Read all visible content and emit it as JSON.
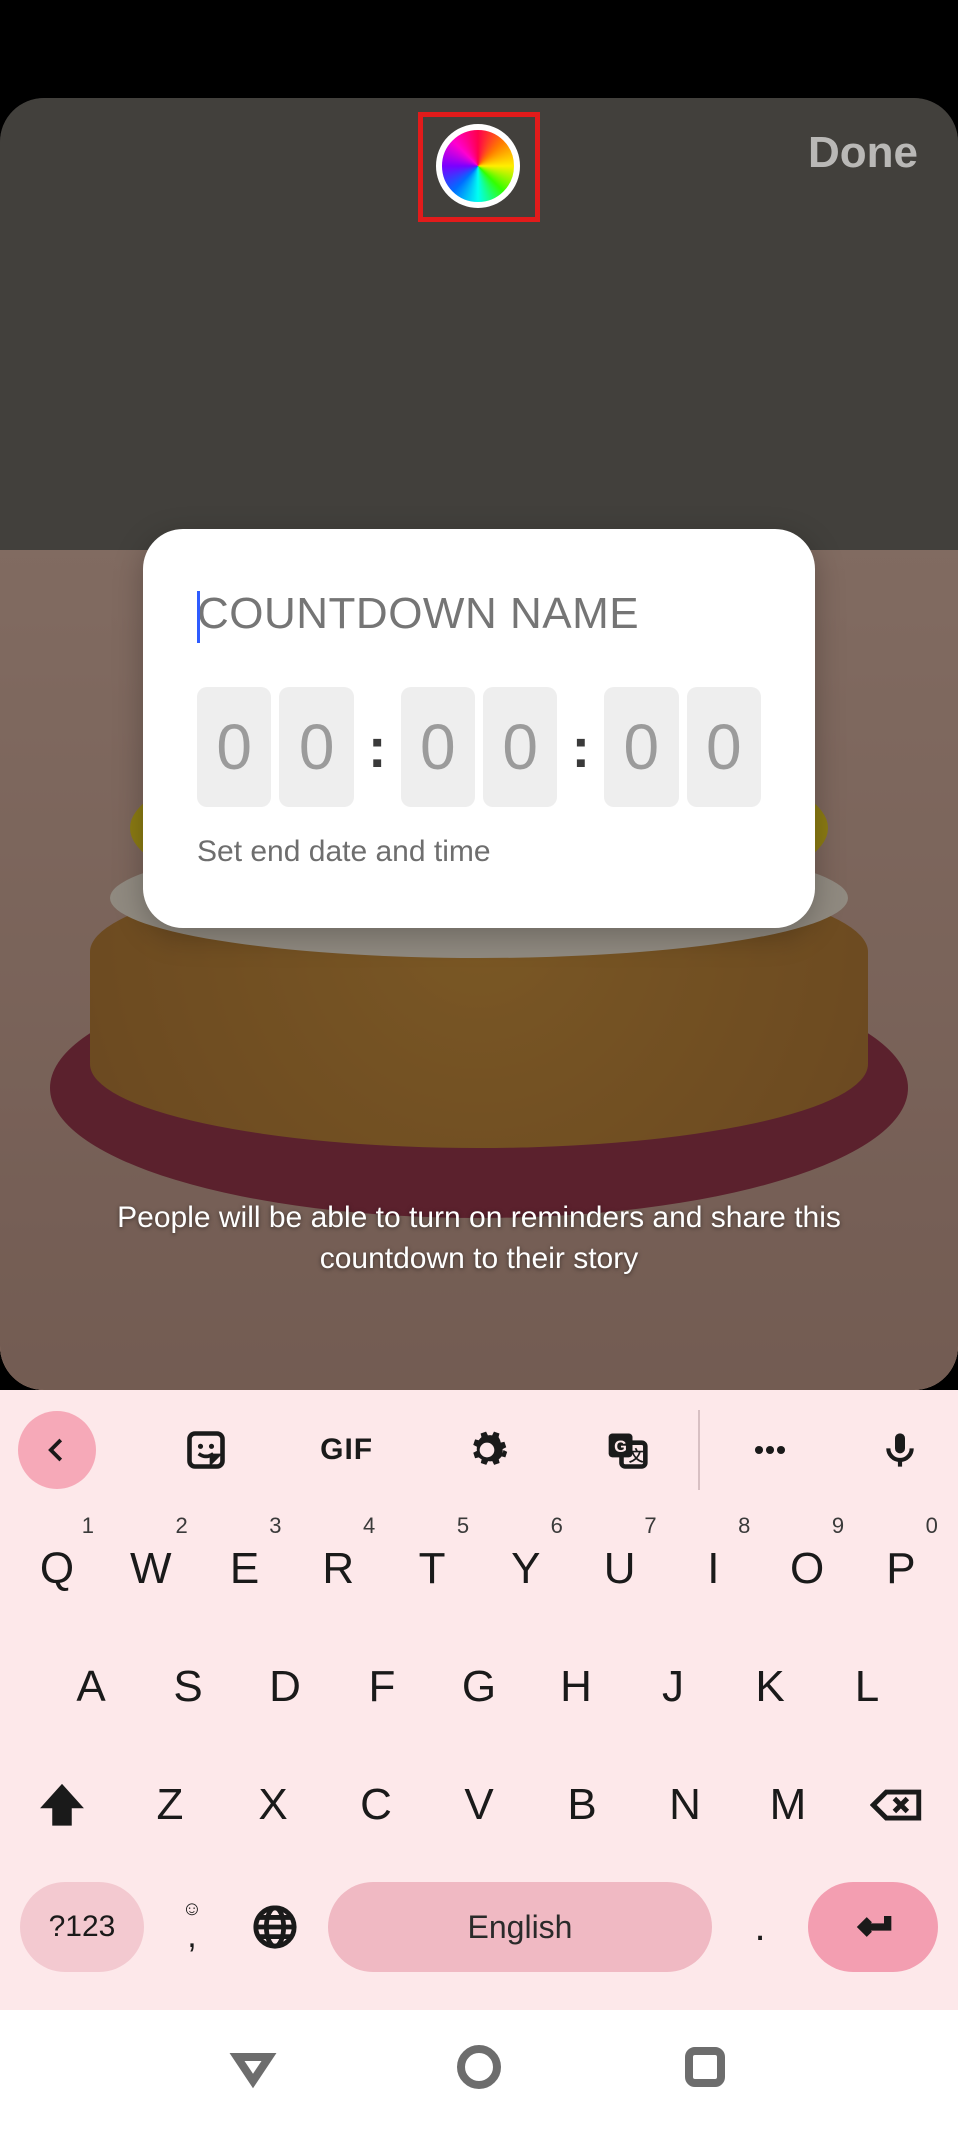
{
  "topbar": {
    "done_label": "Done",
    "color_picker_name": "color-wheel"
  },
  "countdown": {
    "name_placeholder": "COUNTDOWN NAME",
    "digits": [
      "0",
      "0",
      "0",
      "0",
      "0",
      "0"
    ],
    "subtext": "Set end date and time"
  },
  "info_text_line1": "People will be able to turn on reminders and share this",
  "info_text_line2": "countdown to their story",
  "keyboard": {
    "toolbar": {
      "gif_label": "GIF"
    },
    "row1": [
      {
        "k": "Q",
        "s": "1"
      },
      {
        "k": "W",
        "s": "2"
      },
      {
        "k": "E",
        "s": "3"
      },
      {
        "k": "R",
        "s": "4"
      },
      {
        "k": "T",
        "s": "5"
      },
      {
        "k": "Y",
        "s": "6"
      },
      {
        "k": "U",
        "s": "7"
      },
      {
        "k": "I",
        "s": "8"
      },
      {
        "k": "O",
        "s": "9"
      },
      {
        "k": "P",
        "s": "0"
      }
    ],
    "row2": [
      "A",
      "S",
      "D",
      "F",
      "G",
      "H",
      "J",
      "K",
      "L"
    ],
    "row3": [
      "Z",
      "X",
      "C",
      "V",
      "B",
      "N",
      "M"
    ],
    "sym_label": "?123",
    "comma_label": ",",
    "comma_face": "☺",
    "space_label": "English",
    "period_label": "."
  }
}
